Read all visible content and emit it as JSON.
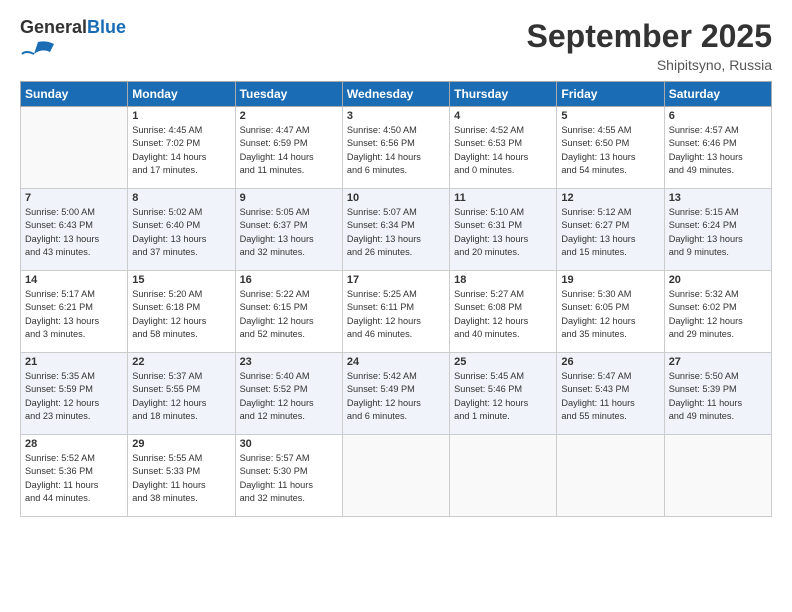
{
  "header": {
    "logo_general": "General",
    "logo_blue": "Blue",
    "month": "September 2025",
    "location": "Shipitsyno, Russia"
  },
  "weekdays": [
    "Sunday",
    "Monday",
    "Tuesday",
    "Wednesday",
    "Thursday",
    "Friday",
    "Saturday"
  ],
  "weeks": [
    [
      {
        "day": "",
        "info": ""
      },
      {
        "day": "1",
        "info": "Sunrise: 4:45 AM\nSunset: 7:02 PM\nDaylight: 14 hours\nand 17 minutes."
      },
      {
        "day": "2",
        "info": "Sunrise: 4:47 AM\nSunset: 6:59 PM\nDaylight: 14 hours\nand 11 minutes."
      },
      {
        "day": "3",
        "info": "Sunrise: 4:50 AM\nSunset: 6:56 PM\nDaylight: 14 hours\nand 6 minutes."
      },
      {
        "day": "4",
        "info": "Sunrise: 4:52 AM\nSunset: 6:53 PM\nDaylight: 14 hours\nand 0 minutes."
      },
      {
        "day": "5",
        "info": "Sunrise: 4:55 AM\nSunset: 6:50 PM\nDaylight: 13 hours\nand 54 minutes."
      },
      {
        "day": "6",
        "info": "Sunrise: 4:57 AM\nSunset: 6:46 PM\nDaylight: 13 hours\nand 49 minutes."
      }
    ],
    [
      {
        "day": "7",
        "info": "Sunrise: 5:00 AM\nSunset: 6:43 PM\nDaylight: 13 hours\nand 43 minutes."
      },
      {
        "day": "8",
        "info": "Sunrise: 5:02 AM\nSunset: 6:40 PM\nDaylight: 13 hours\nand 37 minutes."
      },
      {
        "day": "9",
        "info": "Sunrise: 5:05 AM\nSunset: 6:37 PM\nDaylight: 13 hours\nand 32 minutes."
      },
      {
        "day": "10",
        "info": "Sunrise: 5:07 AM\nSunset: 6:34 PM\nDaylight: 13 hours\nand 26 minutes."
      },
      {
        "day": "11",
        "info": "Sunrise: 5:10 AM\nSunset: 6:31 PM\nDaylight: 13 hours\nand 20 minutes."
      },
      {
        "day": "12",
        "info": "Sunrise: 5:12 AM\nSunset: 6:27 PM\nDaylight: 13 hours\nand 15 minutes."
      },
      {
        "day": "13",
        "info": "Sunrise: 5:15 AM\nSunset: 6:24 PM\nDaylight: 13 hours\nand 9 minutes."
      }
    ],
    [
      {
        "day": "14",
        "info": "Sunrise: 5:17 AM\nSunset: 6:21 PM\nDaylight: 13 hours\nand 3 minutes."
      },
      {
        "day": "15",
        "info": "Sunrise: 5:20 AM\nSunset: 6:18 PM\nDaylight: 12 hours\nand 58 minutes."
      },
      {
        "day": "16",
        "info": "Sunrise: 5:22 AM\nSunset: 6:15 PM\nDaylight: 12 hours\nand 52 minutes."
      },
      {
        "day": "17",
        "info": "Sunrise: 5:25 AM\nSunset: 6:11 PM\nDaylight: 12 hours\nand 46 minutes."
      },
      {
        "day": "18",
        "info": "Sunrise: 5:27 AM\nSunset: 6:08 PM\nDaylight: 12 hours\nand 40 minutes."
      },
      {
        "day": "19",
        "info": "Sunrise: 5:30 AM\nSunset: 6:05 PM\nDaylight: 12 hours\nand 35 minutes."
      },
      {
        "day": "20",
        "info": "Sunrise: 5:32 AM\nSunset: 6:02 PM\nDaylight: 12 hours\nand 29 minutes."
      }
    ],
    [
      {
        "day": "21",
        "info": "Sunrise: 5:35 AM\nSunset: 5:59 PM\nDaylight: 12 hours\nand 23 minutes."
      },
      {
        "day": "22",
        "info": "Sunrise: 5:37 AM\nSunset: 5:55 PM\nDaylight: 12 hours\nand 18 minutes."
      },
      {
        "day": "23",
        "info": "Sunrise: 5:40 AM\nSunset: 5:52 PM\nDaylight: 12 hours\nand 12 minutes."
      },
      {
        "day": "24",
        "info": "Sunrise: 5:42 AM\nSunset: 5:49 PM\nDaylight: 12 hours\nand 6 minutes."
      },
      {
        "day": "25",
        "info": "Sunrise: 5:45 AM\nSunset: 5:46 PM\nDaylight: 12 hours\nand 1 minute."
      },
      {
        "day": "26",
        "info": "Sunrise: 5:47 AM\nSunset: 5:43 PM\nDaylight: 11 hours\nand 55 minutes."
      },
      {
        "day": "27",
        "info": "Sunrise: 5:50 AM\nSunset: 5:39 PM\nDaylight: 11 hours\nand 49 minutes."
      }
    ],
    [
      {
        "day": "28",
        "info": "Sunrise: 5:52 AM\nSunset: 5:36 PM\nDaylight: 11 hours\nand 44 minutes."
      },
      {
        "day": "29",
        "info": "Sunrise: 5:55 AM\nSunset: 5:33 PM\nDaylight: 11 hours\nand 38 minutes."
      },
      {
        "day": "30",
        "info": "Sunrise: 5:57 AM\nSunset: 5:30 PM\nDaylight: 11 hours\nand 32 minutes."
      },
      {
        "day": "",
        "info": ""
      },
      {
        "day": "",
        "info": ""
      },
      {
        "day": "",
        "info": ""
      },
      {
        "day": "",
        "info": ""
      }
    ]
  ]
}
